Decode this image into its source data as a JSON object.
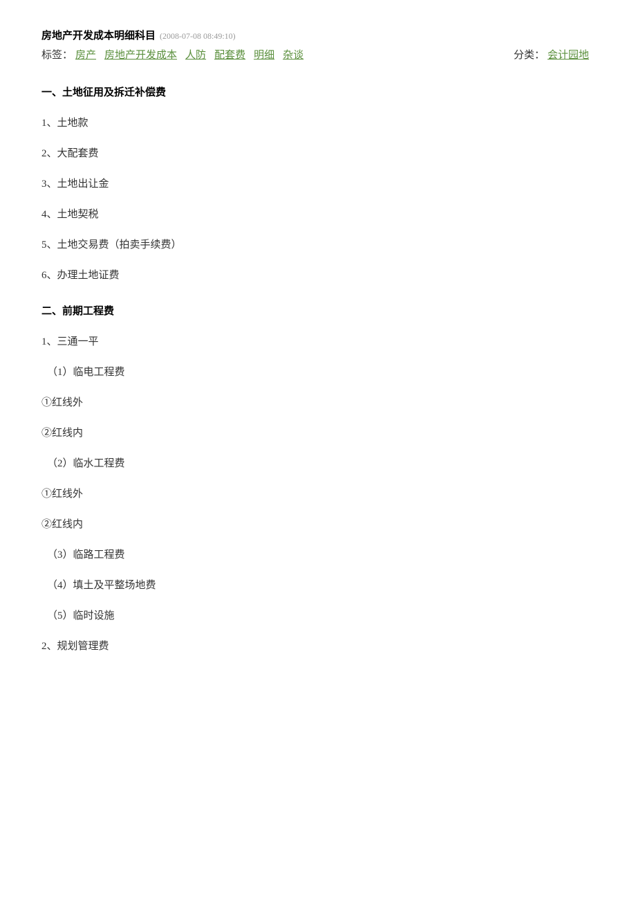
{
  "header": {
    "title": "房地产开发成本明细科目",
    "timestamp": "(2008-07-08 08:49:10)"
  },
  "meta": {
    "tags_label": "标签：",
    "tags": [
      "房产",
      "房地产开发成本",
      "人防",
      "配套费",
      "明细",
      "杂谈"
    ],
    "category_label": "分类：",
    "category": "会计园地"
  },
  "sections": {
    "s1_heading": "一、土地征用及拆迁补偿费",
    "s1_items": {
      "i1": "1、土地款",
      "i2": "2、大配套费",
      "i3": "3、土地出让金",
      "i4": "4、土地契税",
      "i5": "5、土地交易费（拍卖手续费）",
      "i6": "6、办理土地证费"
    },
    "s2_heading": "二、前期工程费",
    "s2_items": {
      "i1": "1、三通一平",
      "i1_1": "（1）临电工程费",
      "i1_1a": "①红线外",
      "i1_1b": "②红线内",
      "i1_2": "（2）临水工程费",
      "i1_2a": "①红线外",
      "i1_2b": "②红线内",
      "i1_3": "（3）临路工程费",
      "i1_4": "（4）填土及平整场地费",
      "i1_5": "（5）临时设施",
      "i2": "2、规划管理费"
    }
  }
}
